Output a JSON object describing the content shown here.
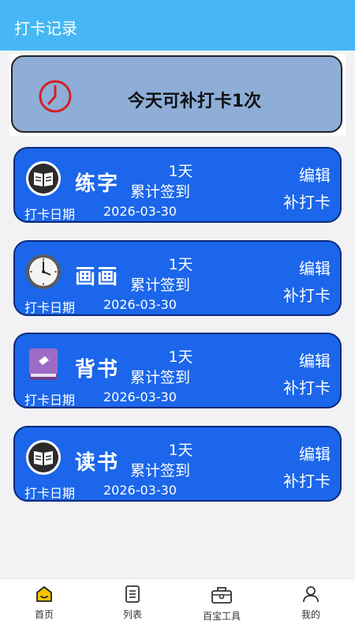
{
  "header": {
    "title": "打卡记录"
  },
  "banner": {
    "text": "今天可补打卡1次"
  },
  "cards": [
    {
      "name": "练字",
      "icon": "book-reading-icon",
      "days": "1天",
      "total_label": "累计签到",
      "edit_label": "编辑",
      "makeup_label": "补打卡",
      "date_label": "打卡日期",
      "date": "2026-03-30"
    },
    {
      "name": "画画",
      "icon": "wall-clock-icon",
      "days": "1天",
      "total_label": "累计签到",
      "edit_label": "编辑",
      "makeup_label": "补打卡",
      "date_label": "打卡日期",
      "date": "2026-03-30"
    },
    {
      "name": "背书",
      "icon": "purple-book-icon",
      "days": "1天",
      "total_label": "累计签到",
      "edit_label": "编辑",
      "makeup_label": "补打卡",
      "date_label": "打卡日期",
      "date": "2026-03-30"
    },
    {
      "name": "读书",
      "icon": "book-reading-icon",
      "days": "1天",
      "total_label": "累计签到",
      "edit_label": "编辑",
      "makeup_label": "补打卡",
      "date_label": "打卡日期",
      "date": "2026-03-30"
    }
  ],
  "tabs": [
    {
      "label": "首页",
      "icon": "home-icon",
      "active": true
    },
    {
      "label": "列表",
      "icon": "list-icon",
      "active": false
    },
    {
      "label": "百宝工具",
      "icon": "toolbox-icon",
      "active": false
    },
    {
      "label": "我的",
      "icon": "user-icon",
      "active": false
    }
  ],
  "colors": {
    "header": "#46b7f4",
    "card": "#1b66ea",
    "banner": "#8eaed8",
    "active_tab": "#f5c400"
  }
}
